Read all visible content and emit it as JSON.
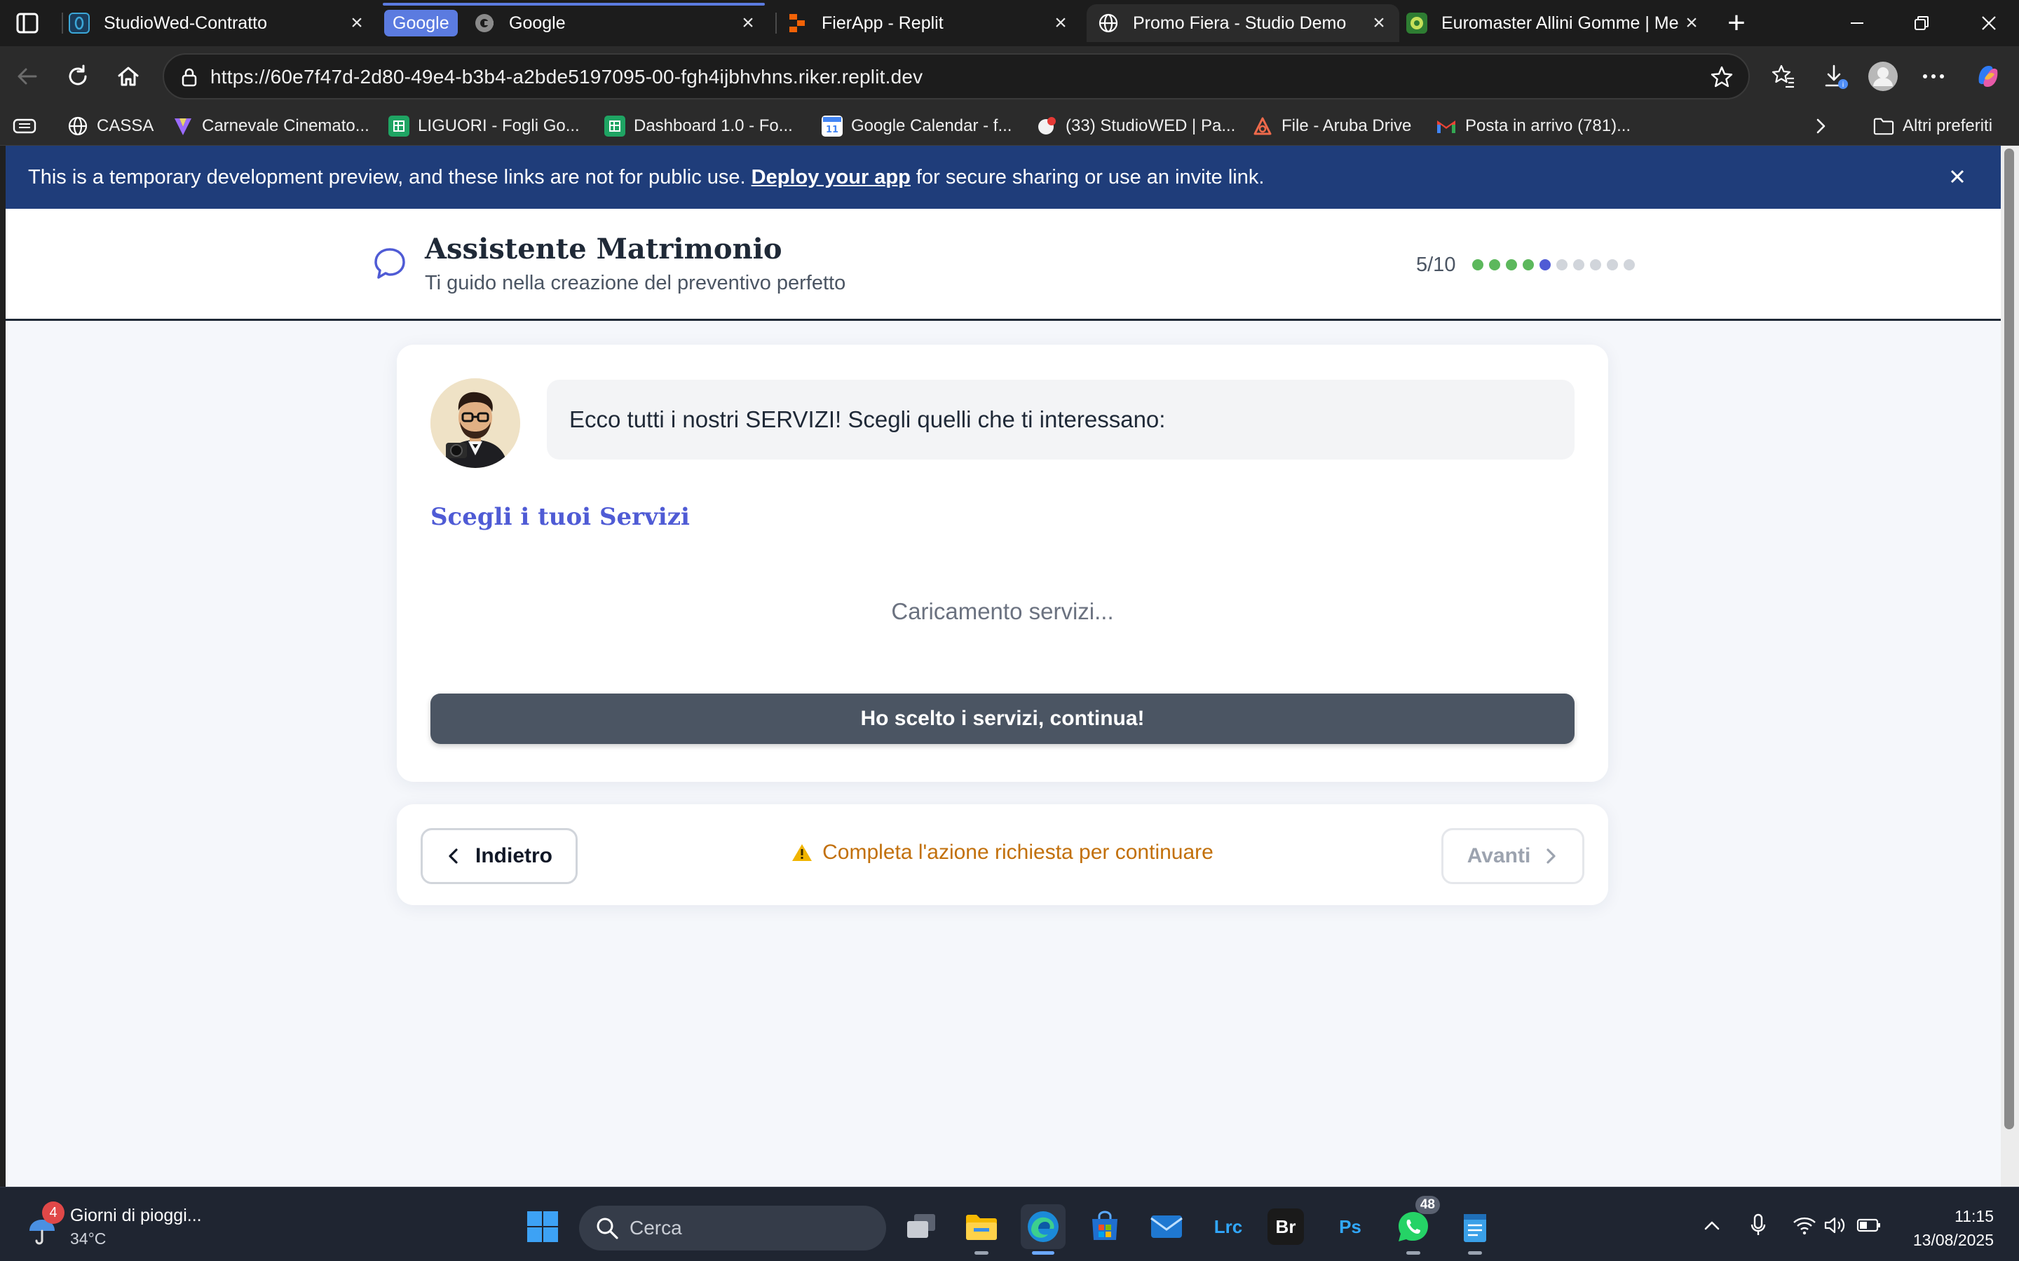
{
  "browser": {
    "tabs": [
      {
        "title": "StudioWed-Contratto",
        "active": false
      },
      {
        "title": "Google",
        "active": false,
        "group": "Google"
      },
      {
        "title": "FierApp - Replit",
        "active": false
      },
      {
        "title": "Promo Fiera - Studio Demo",
        "active": true
      },
      {
        "title": "Euromaster Allini Gomme | Me",
        "active": false
      }
    ],
    "tab_group_label": "Google",
    "url": "https://60e7f47d-2d80-49e4-b3b4-a2bde5197095-00-fgh4ijbhvhns.riker.replit.dev",
    "bookmarks": [
      {
        "label": "CASSA",
        "icon": "globe-icon"
      },
      {
        "label": "Carnevale Cinemato...",
        "icon": "vuetify-icon"
      },
      {
        "label": "LIGUORI - Fogli Go...",
        "icon": "sheets-icon"
      },
      {
        "label": "Dashboard 1.0 - Fo...",
        "icon": "sheets-icon"
      },
      {
        "label": "Google Calendar - f...",
        "icon": "calendar-icon"
      },
      {
        "label": "(33) StudioWED | Pa...",
        "icon": "studiowed-icon"
      },
      {
        "label": "File - Aruba Drive",
        "icon": "aruba-icon"
      },
      {
        "label": "Posta in arrivo (781)...",
        "icon": "gmail-icon"
      }
    ],
    "other_favorites": "Altri preferiti"
  },
  "dev_banner": {
    "text_before": "This is a temporary development preview, and these links are not for public use.",
    "link": "Deploy your app",
    "text_after": "for secure sharing or use an invite link."
  },
  "app": {
    "title": "Assistente Matrimonio",
    "subtitle": "Ti guido nella creazione del preventivo perfetto",
    "step_text": "5/10",
    "progress": {
      "current": 5,
      "completed": 4,
      "total": 10
    },
    "colors": {
      "done": "#5cb85c",
      "current": "#4f5bd5",
      "pending": "#d1d5db",
      "accent": "#4f5bd5",
      "warning": "#c2700b"
    },
    "message": "Ecco tutti i nostri SERVIZI! Scegli quelli che ti interessano:",
    "section_title": "Scegli i tuoi Servizi",
    "loading_text": "Caricamento servizi...",
    "continue_label": "Ho scelto i servizi, continua!",
    "back_label": "Indietro",
    "warning_text": "Completa l'azione richiesta per continuare",
    "next_label": "Avanti"
  },
  "taskbar": {
    "weather_badge": "4",
    "weather_title": "Giorni di pioggi...",
    "weather_temp": "34°C",
    "search_placeholder": "Cerca",
    "apps": [
      "task-view",
      "file-explorer",
      "edge",
      "microsoft-store",
      "mail",
      "lightroom-classic",
      "bridge",
      "photoshop",
      "whatsapp",
      "notepad"
    ],
    "lrc_label": "Lrc",
    "br_label": "Br",
    "ps_label": "Ps",
    "whatsapp_badge": "48",
    "time": "11:15",
    "date": "13/08/2025"
  }
}
